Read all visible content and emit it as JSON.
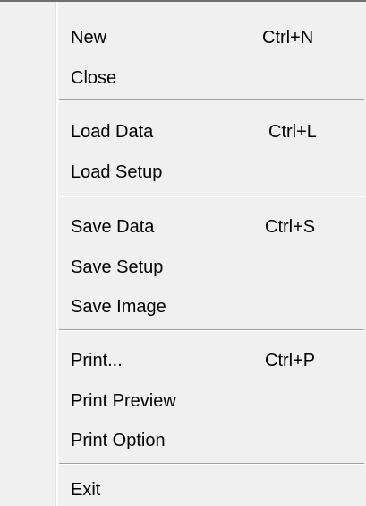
{
  "menu": {
    "items": [
      {
        "label": "New",
        "shortcut": "Ctrl+N"
      },
      {
        "label": "Close",
        "shortcut": ""
      },
      {
        "label": "Load Data",
        "shortcut": "Ctrl+L"
      },
      {
        "label": "Load Setup",
        "shortcut": ""
      },
      {
        "label": "Save Data",
        "shortcut": "Ctrl+S"
      },
      {
        "label": "Save Setup",
        "shortcut": ""
      },
      {
        "label": "Save Image",
        "shortcut": ""
      },
      {
        "label": "Print...",
        "shortcut": "Ctrl+P"
      },
      {
        "label": "Print Preview",
        "shortcut": ""
      },
      {
        "label": "Print Option",
        "shortcut": ""
      },
      {
        "label": "Exit",
        "shortcut": ""
      }
    ]
  },
  "colors": {
    "menu_background": "#f0f0f0",
    "separator": "#a0a0a0",
    "text": "#000000"
  }
}
